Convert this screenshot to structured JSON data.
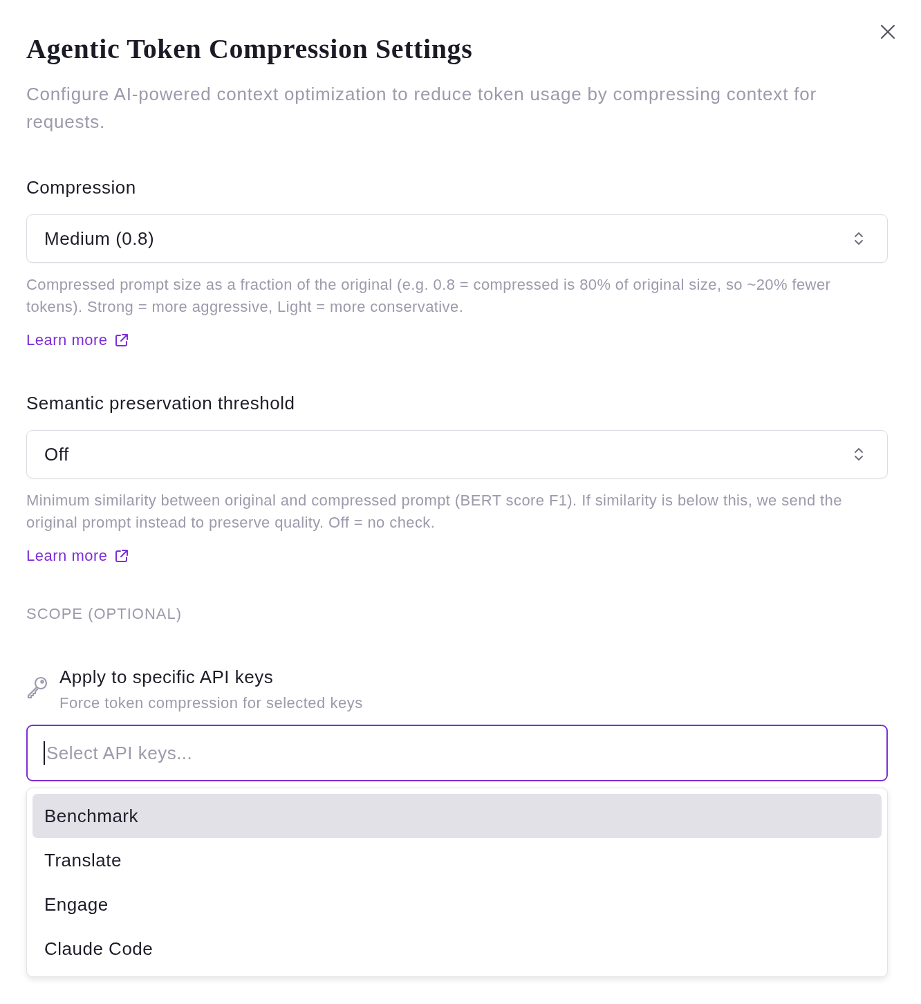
{
  "dialog": {
    "title": "Agentic Token Compression Settings",
    "description": "Configure AI-powered context optimization to reduce token usage by compressing context for requests."
  },
  "fields": [
    {
      "kind": "select",
      "label": "Compression",
      "value": "Medium (0.8)",
      "help": "Compressed prompt size as a fraction of the original (e.g. 0.8 = compressed is 80% of original size, so ~20% fewer tokens). Strong = more aggressive, Light = more conservative.",
      "link": "Learn more"
    },
    {
      "kind": "select",
      "label": "Semantic preservation threshold",
      "value": "Off",
      "help": "Minimum similarity between original and compressed prompt (BERT score F1). If similarity is below this, we send the original prompt instead to preserve quality. Off = no check.",
      "link": "Learn more"
    }
  ],
  "scope": {
    "heading": "SCOPE (OPTIONAL)",
    "title": "Apply to specific API keys",
    "subtitle": "Force token compression for selected keys",
    "input": {
      "placeholder": "Select API keys...",
      "focused": true
    },
    "options": [
      {
        "label": "Benchmark",
        "selected": true
      },
      {
        "label": "Translate",
        "selected": false
      },
      {
        "label": "Engage",
        "selected": false
      },
      {
        "label": "Claude Code",
        "selected": false
      }
    ]
  }
}
